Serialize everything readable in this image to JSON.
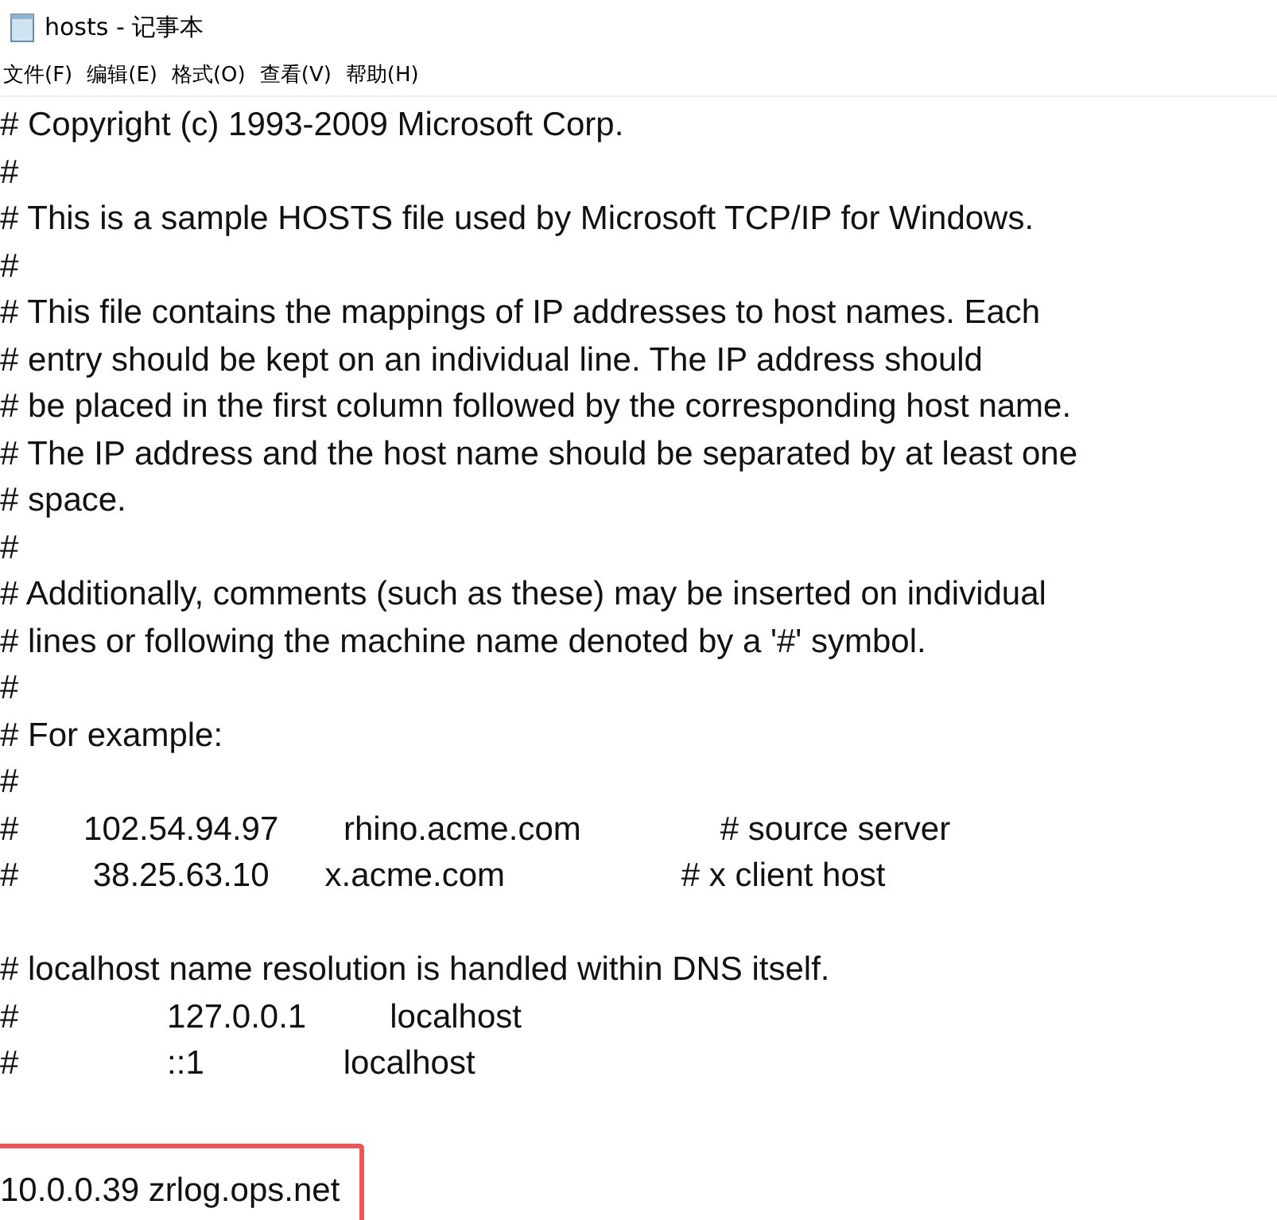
{
  "window": {
    "title": "hosts - 记事本"
  },
  "menu": [
    {
      "label": "文件(F)"
    },
    {
      "label": "编辑(E)"
    },
    {
      "label": "格式(O)"
    },
    {
      "label": "查看(V)"
    },
    {
      "label": "帮助(H)"
    }
  ],
  "lines": [
    {
      "kind": "text",
      "text": "# Copyright (c) 1993-2009 Microsoft Corp."
    },
    {
      "kind": "text",
      "text": "#"
    },
    {
      "kind": "text",
      "text": "# This is a sample HOSTS file used by Microsoft TCP/IP for Windows."
    },
    {
      "kind": "text",
      "text": "#"
    },
    {
      "kind": "text",
      "text": "# This file contains the mappings of IP addresses to host names. Each"
    },
    {
      "kind": "text",
      "text": "# entry should be kept on an individual line. The IP address should"
    },
    {
      "kind": "text",
      "text": "# be placed in the first column followed by the corresponding host name."
    },
    {
      "kind": "text",
      "text": "# The IP address and the host name should be separated by at least one"
    },
    {
      "kind": "text",
      "text": "# space."
    },
    {
      "kind": "text",
      "text": "#"
    },
    {
      "kind": "text",
      "text": "# Additionally, comments (such as these) may be inserted on individual"
    },
    {
      "kind": "text",
      "text": "# lines or following the machine name denoted by a '#' symbol."
    },
    {
      "kind": "text",
      "text": "#"
    },
    {
      "kind": "text",
      "text": "# For example:"
    },
    {
      "kind": "text",
      "text": "#"
    },
    {
      "kind": "text",
      "text": "#       102.54.94.97       rhino.acme.com               # source server"
    },
    {
      "kind": "text",
      "text": "#        38.25.63.10      x.acme.com                   # x client host"
    },
    {
      "kind": "blank"
    },
    {
      "kind": "text",
      "text": "# localhost name resolution is handled within DNS itself."
    },
    {
      "kind": "text",
      "text": "#                127.0.0.1         localhost"
    },
    {
      "kind": "text",
      "text": "#                ::1               localhost"
    },
    {
      "kind": "blank"
    },
    {
      "kind": "text",
      "text": "10.0.0.39 zrlog.ops.net",
      "highlighted": true
    }
  ]
}
